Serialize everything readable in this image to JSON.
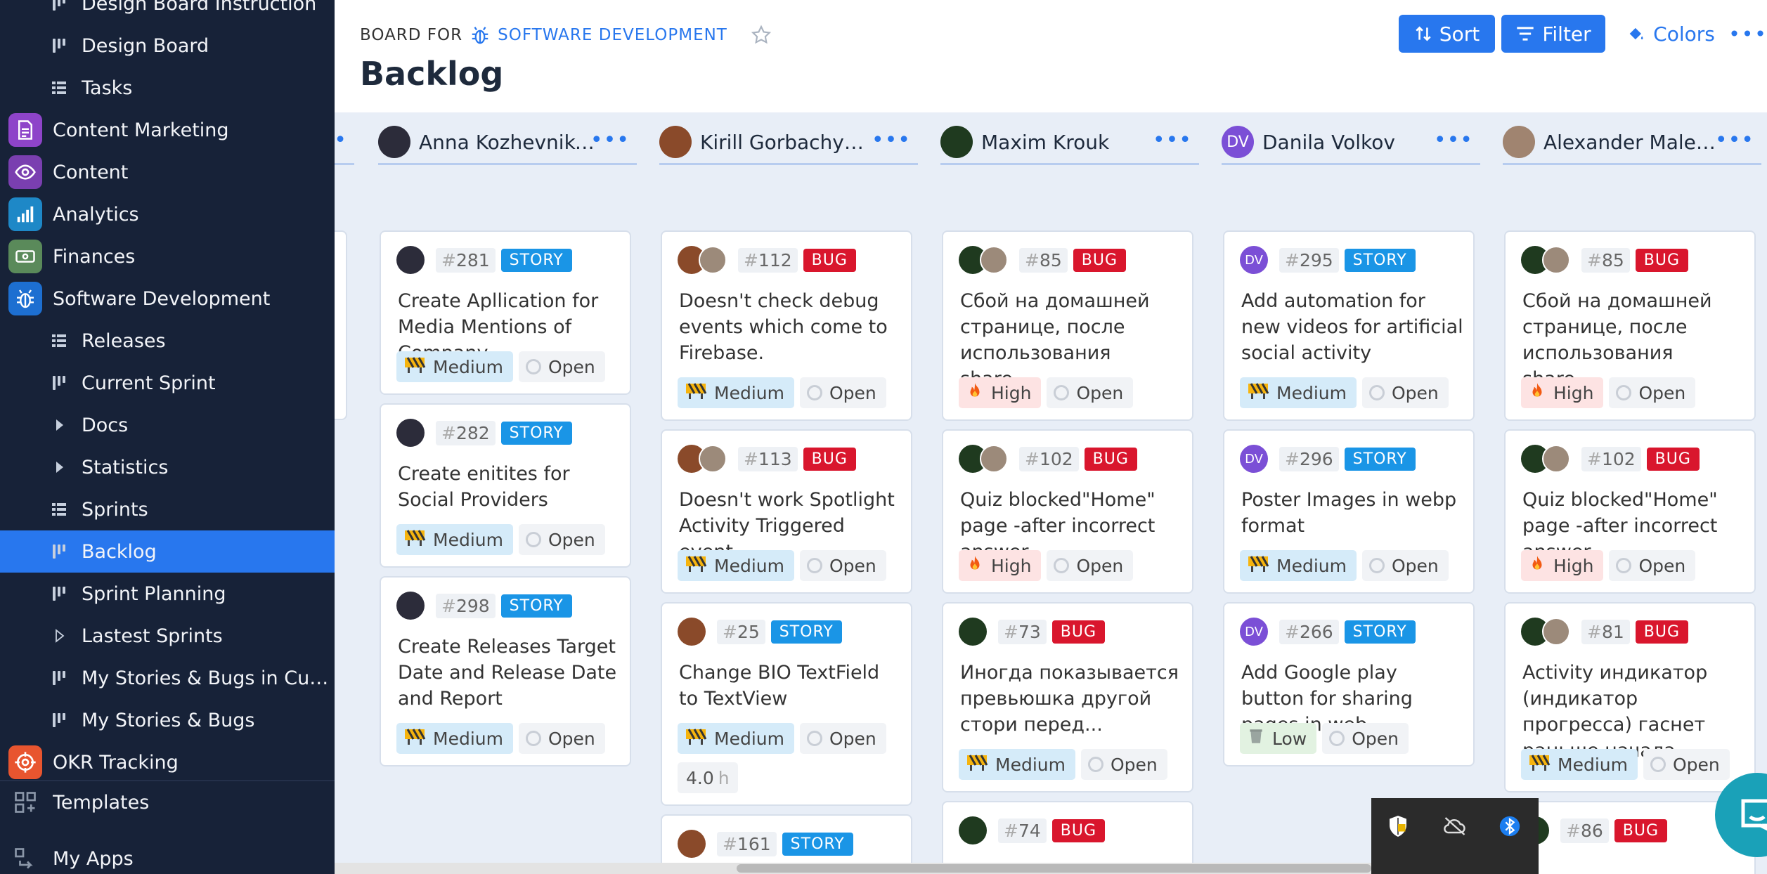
{
  "sidebar": {
    "items": [
      {
        "label": "Design Board Instruction",
        "kind": "board"
      },
      {
        "label": "Design Board",
        "kind": "board"
      },
      {
        "label": "Tasks",
        "kind": "list"
      },
      {
        "label": "Content Marketing",
        "kind": "app",
        "color": "#8e44c9",
        "icon": "document-icon"
      },
      {
        "label": "Content",
        "kind": "app",
        "color": "#7a3fb0",
        "icon": "eye-icon"
      },
      {
        "label": "Analytics",
        "kind": "app",
        "color": "#1e88c7",
        "icon": "bar-chart-icon"
      },
      {
        "label": "Finances",
        "kind": "app",
        "color": "#5a8a5a",
        "icon": "money-icon"
      },
      {
        "label": "Software Development",
        "kind": "app",
        "color": "#1d6fd1",
        "icon": "bug-icon"
      },
      {
        "label": "Releases",
        "kind": "list"
      },
      {
        "label": "Current Sprint",
        "kind": "board"
      },
      {
        "label": "Docs",
        "kind": "folder"
      },
      {
        "label": "Statistics",
        "kind": "folder"
      },
      {
        "label": "Sprints",
        "kind": "list"
      },
      {
        "label": "Backlog",
        "kind": "board",
        "active": true
      },
      {
        "label": "Sprint Planning",
        "kind": "board"
      },
      {
        "label": "Lastest Sprints",
        "kind": "folder-outline"
      },
      {
        "label": "My Stories & Bugs in Curre...",
        "kind": "board"
      },
      {
        "label": "My Stories & Bugs",
        "kind": "board"
      },
      {
        "label": "OKR Tracking",
        "kind": "app",
        "color": "#e8552f",
        "icon": "target-icon"
      }
    ],
    "templates_label": "Templates",
    "my_apps_label": "My Apps"
  },
  "header": {
    "board_for_label": "BOARD FOR",
    "project_name": "SOFTWARE DEVELOPMENT",
    "title": "Backlog",
    "sort_label": "Sort",
    "filter_label": "Filter",
    "colors_label": "Colors",
    "more_label": "•••"
  },
  "columns": [
    {
      "name": "Anna Kozhevniko...",
      "avatar": {
        "color": "#2c2c3a",
        "initials": ""
      },
      "cards": [
        {
          "number": "281",
          "type": "STORY",
          "title": "Create Apllication for Media Mentions of Company",
          "priority": "Medium",
          "status": "Open",
          "avatars": [
            {
              "color": "#2c2c3a",
              "initials": ""
            }
          ]
        },
        {
          "number": "282",
          "type": "STORY",
          "title": "Create enitites for Social Providers",
          "priority": "Medium",
          "status": "Open",
          "avatars": [
            {
              "color": "#2c2c3a",
              "initials": ""
            }
          ]
        },
        {
          "number": "298",
          "type": "STORY",
          "title": "Create Releases Target Date and Release Date and Report",
          "priority": "Medium",
          "status": "Open",
          "avatars": [
            {
              "color": "#2c2c3a",
              "initials": ""
            }
          ]
        }
      ]
    },
    {
      "name": "Kirill Gorbachyon...",
      "avatar": {
        "color": "#8a4a2a",
        "initials": ""
      },
      "cards": [
        {
          "number": "112",
          "type": "BUG",
          "title": "Doesn't check debug events which come to Firebase.",
          "priority": "Medium",
          "status": "Open",
          "avatars": [
            {
              "color": "#8a4a2a",
              "initials": ""
            },
            {
              "color": "#9c8a7a",
              "initials": ""
            }
          ]
        },
        {
          "number": "113",
          "type": "BUG",
          "title": "Doesn't work Spotlight Activity Triggered event",
          "priority": "Medium",
          "status": "Open",
          "avatars": [
            {
              "color": "#8a4a2a",
              "initials": ""
            },
            {
              "color": "#9c8a7a",
              "initials": ""
            }
          ]
        },
        {
          "number": "25",
          "type": "STORY",
          "title": "Change BIO TextField to TextView",
          "priority": "Medium",
          "status": "Open",
          "estimate": "4.0",
          "estimate_unit": "h",
          "avatars": [
            {
              "color": "#8a4a2a",
              "initials": ""
            }
          ]
        },
        {
          "number": "161",
          "type": "STORY",
          "title": "",
          "priority": "",
          "status": "",
          "avatars": [
            {
              "color": "#8a4a2a",
              "initials": ""
            }
          ]
        }
      ]
    },
    {
      "name": "Maxim Krouk",
      "avatar": {
        "color": "#1f3a1f",
        "initials": ""
      },
      "cards": [
        {
          "number": "85",
          "type": "BUG",
          "title": "Сбой на домашней странице, после использования share...",
          "priority": "High",
          "status": "Open",
          "avatars": [
            {
              "color": "#1f3a1f",
              "initials": ""
            },
            {
              "color": "#9c8a7a",
              "initials": ""
            }
          ]
        },
        {
          "number": "102",
          "type": "BUG",
          "title": "Quiz blocked\"Home\" page -after incorrect answer",
          "priority": "High",
          "status": "Open",
          "avatars": [
            {
              "color": "#1f3a1f",
              "initials": ""
            },
            {
              "color": "#9c8a7a",
              "initials": ""
            }
          ]
        },
        {
          "number": "73",
          "type": "BUG",
          "title": "Иногда показывается превьюшка другой стори перед...",
          "priority": "Medium",
          "status": "Open",
          "avatars": [
            {
              "color": "#1f3a1f",
              "initials": ""
            }
          ]
        },
        {
          "number": "74",
          "type": "BUG",
          "title": "",
          "priority": "",
          "status": "",
          "avatars": [
            {
              "color": "#1f3a1f",
              "initials": ""
            }
          ]
        }
      ]
    },
    {
      "name": "Danila Volkov",
      "avatar": {
        "color": "#7b4fd6",
        "initials": "DV"
      },
      "cards": [
        {
          "number": "295",
          "type": "STORY",
          "title": "Add automation for new videos for artificial social activity",
          "priority": "Medium",
          "status": "Open",
          "avatars": [
            {
              "color": "#7b4fd6",
              "initials": "DV"
            }
          ]
        },
        {
          "number": "296",
          "type": "STORY",
          "title": "Poster Images in webp format",
          "priority": "Medium",
          "status": "Open",
          "avatars": [
            {
              "color": "#7b4fd6",
              "initials": "DV"
            }
          ]
        },
        {
          "number": "266",
          "type": "STORY",
          "title": "Add Google play button for sharing pages in web",
          "priority": "Low",
          "status": "Open",
          "avatars": [
            {
              "color": "#7b4fd6",
              "initials": "DV"
            }
          ]
        }
      ]
    },
    {
      "name": "Alexander Maleiko",
      "avatar": {
        "color": "#a08470",
        "initials": ""
      },
      "cards": [
        {
          "number": "85",
          "type": "BUG",
          "title": "Сбой на домашней странице, после использования share...",
          "priority": "High",
          "status": "Open",
          "avatars": [
            {
              "color": "#1f3a1f",
              "initials": ""
            },
            {
              "color": "#9c8a7a",
              "initials": ""
            }
          ]
        },
        {
          "number": "102",
          "type": "BUG",
          "title": "Quiz blocked\"Home\" page -after incorrect answer",
          "priority": "High",
          "status": "Open",
          "avatars": [
            {
              "color": "#1f3a1f",
              "initials": ""
            },
            {
              "color": "#9c8a7a",
              "initials": ""
            }
          ]
        },
        {
          "number": "81",
          "type": "BUG",
          "title": "Activity индикатор (индикатор прогресса) гаснет раньше начала...",
          "priority": "Medium",
          "status": "Open",
          "avatars": [
            {
              "color": "#1f3a1f",
              "initials": ""
            },
            {
              "color": "#9c8a7a",
              "initials": ""
            }
          ]
        },
        {
          "number": "86",
          "type": "BUG",
          "title": "",
          "priority": "",
          "status": "",
          "avatars": [
            {
              "color": "#1f3a1f",
              "initials": ""
            }
          ]
        }
      ]
    }
  ],
  "colors": {
    "accent": "#2877ee",
    "sidebar_bg": "#172238",
    "story": "#1a95e6",
    "bug": "#d9162d"
  },
  "tray": {
    "icons": [
      "shield-icon",
      "cloud-off-icon",
      "bluetooth-icon"
    ]
  }
}
